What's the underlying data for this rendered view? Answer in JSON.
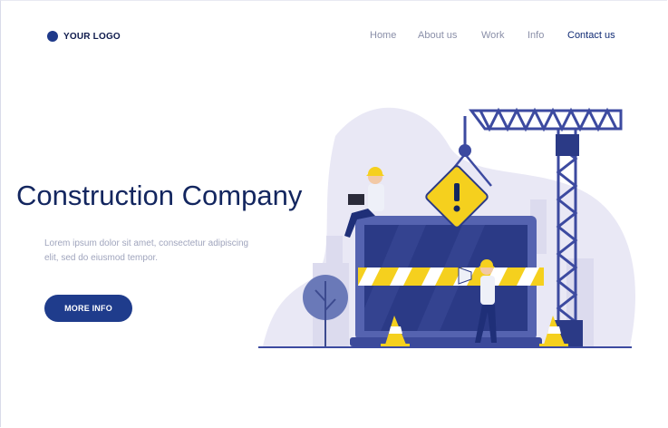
{
  "header": {
    "logo_text": "YOUR LOGO",
    "nav": [
      {
        "label": "Home"
      },
      {
        "label": "About us"
      },
      {
        "label": "Work"
      },
      {
        "label": "Info"
      },
      {
        "label": "Contact us"
      }
    ]
  },
  "hero": {
    "title": "Construction Company",
    "description_line1": "Lorem ipsum dolor sit amet, consectetur adipiscing",
    "description_line2": "elit, sed do eiusmod tempor.",
    "cta_label": "MORE INFO"
  },
  "colors": {
    "brand": "#1f3c8c",
    "accent": "#f5d01e",
    "blob": "#e9e8f5"
  },
  "illustration": {
    "icons": [
      "warning-sign-icon",
      "crane-icon",
      "traffic-cone-icon",
      "laptop-icon",
      "tree-icon",
      "megaphone-icon",
      "worker-icon"
    ]
  }
}
